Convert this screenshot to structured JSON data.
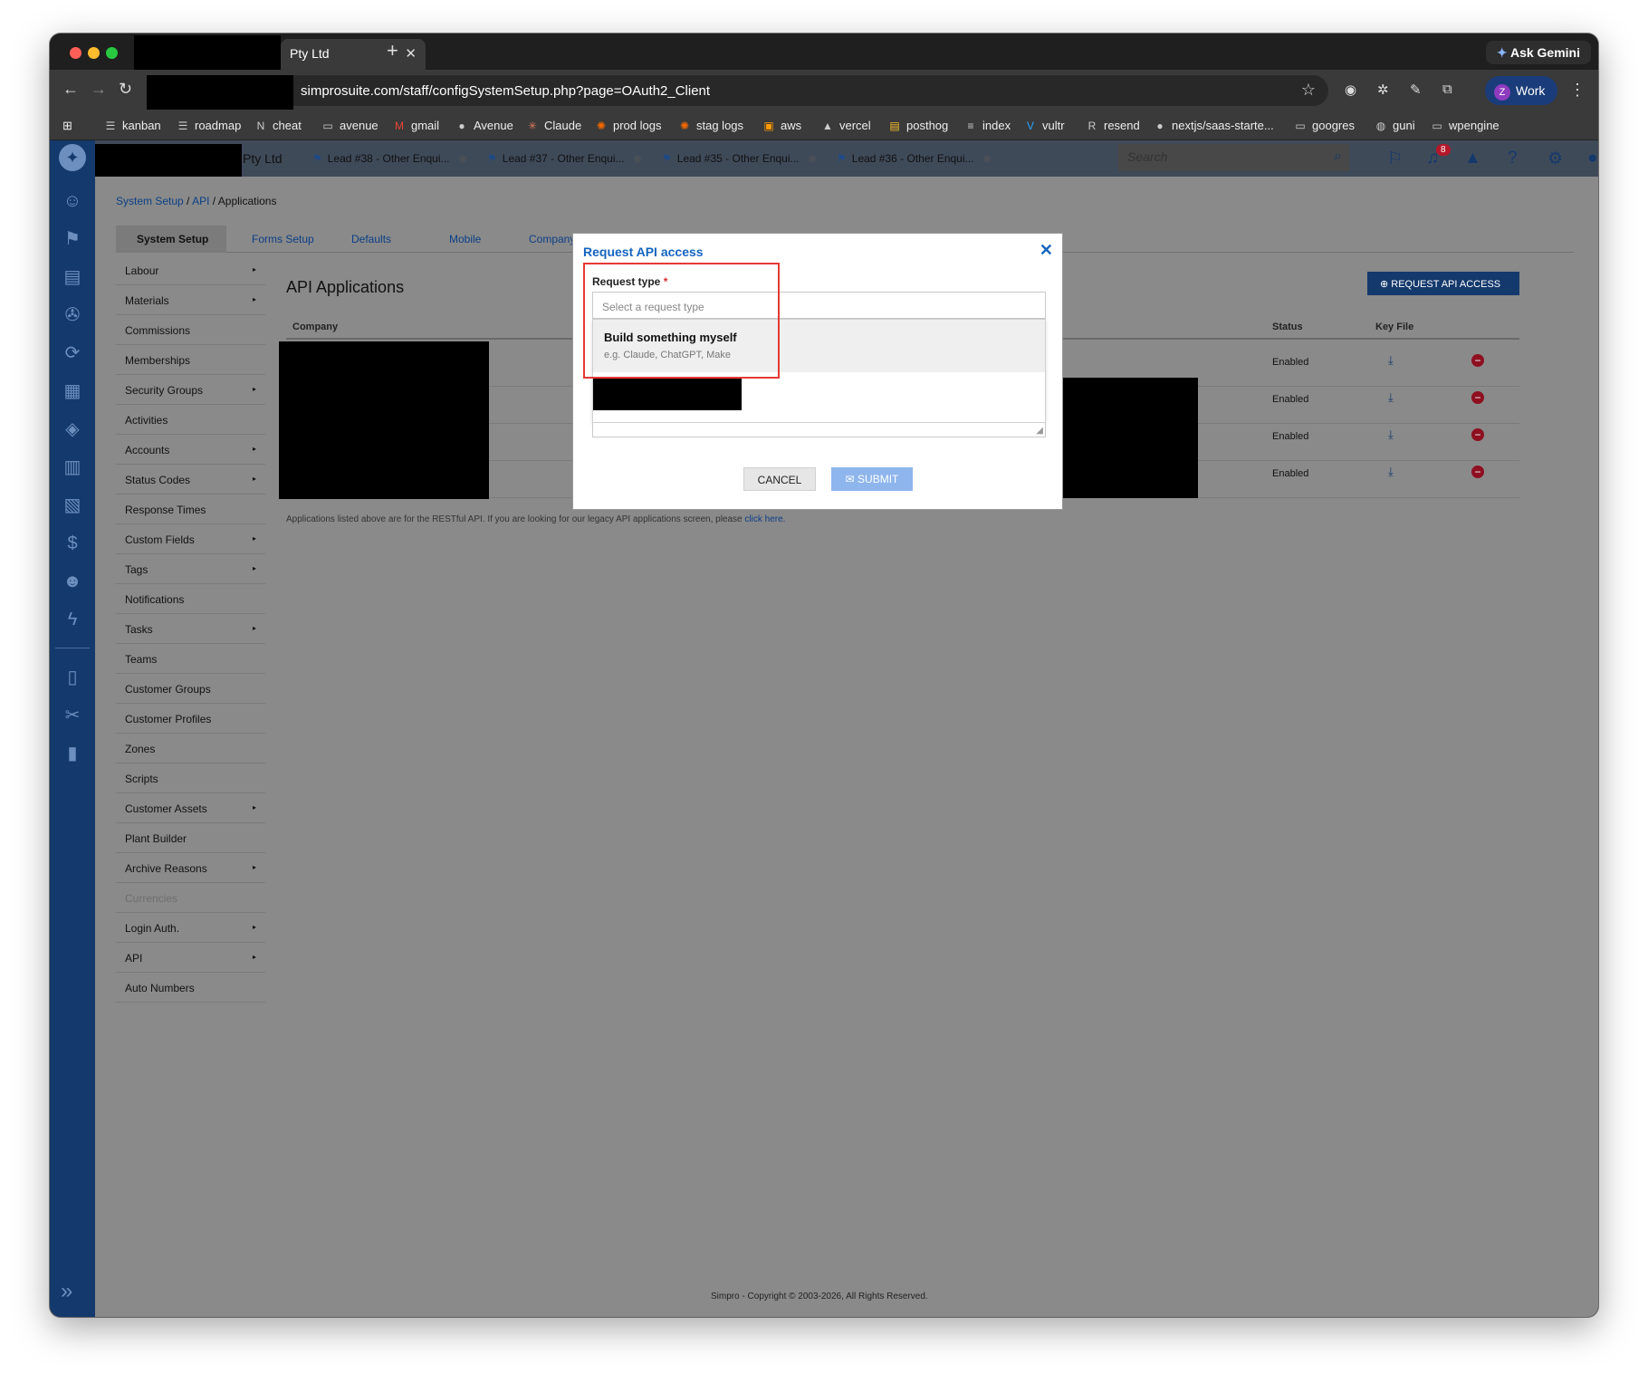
{
  "browser": {
    "active_tab": "Pty Ltd",
    "ask_gemini": "Ask Gemini",
    "url": "simprosuite.com/staff/configSystemSetup.php?page=OAuth2_Client",
    "profile_initial": "Z",
    "profile_label": "Work",
    "bookmarks": [
      "kanban",
      "roadmap",
      "cheat",
      "avenue",
      "gmail",
      "Avenue",
      "Claude",
      "prod logs",
      "stag logs",
      "aws",
      "vercel",
      "posthog",
      "index",
      "vultr",
      "resend",
      "nextjs/saas-starte...",
      "googres",
      "guni",
      "wpengine"
    ]
  },
  "header": {
    "company_suffix": "Pty Ltd",
    "lead_tabs": [
      "Lead #38 - Other Enqui...",
      "Lead #37 - Other Enqui...",
      "Lead #35 - Other Enqui...",
      "Lead #36 - Other Enqui..."
    ],
    "search_placeholder": "Search",
    "notification_count": "8"
  },
  "breadcrumb": {
    "system_setup": "System Setup",
    "api": "API",
    "current": "Applications"
  },
  "tabs": {
    "selected": "System Setup",
    "others": [
      "Forms Setup",
      "Defaults",
      "Mobile",
      "Company"
    ]
  },
  "menu": [
    {
      "label": "Labour",
      "arrow": "▸"
    },
    {
      "label": "Materials",
      "arrow": "▸"
    },
    {
      "label": "Commissions",
      "arrow": ""
    },
    {
      "label": "Memberships",
      "arrow": ""
    },
    {
      "label": "Security Groups",
      "arrow": "▸"
    },
    {
      "label": "Activities",
      "arrow": ""
    },
    {
      "label": "Accounts",
      "arrow": "▸"
    },
    {
      "label": "Status Codes",
      "arrow": "▸"
    },
    {
      "label": "Response Times",
      "arrow": ""
    },
    {
      "label": "Custom Fields",
      "arrow": "▸"
    },
    {
      "label": "Tags",
      "arrow": "▸"
    },
    {
      "label": "Notifications",
      "arrow": ""
    },
    {
      "label": "Tasks",
      "arrow": "▸"
    },
    {
      "label": "Teams",
      "arrow": ""
    },
    {
      "label": "Customer Groups",
      "arrow": ""
    },
    {
      "label": "Customer Profiles",
      "arrow": ""
    },
    {
      "label": "Zones",
      "arrow": ""
    },
    {
      "label": "Scripts",
      "arrow": ""
    },
    {
      "label": "Customer Assets",
      "arrow": "▸"
    },
    {
      "label": "Plant Builder",
      "arrow": ""
    },
    {
      "label": "Archive Reasons",
      "arrow": "▸"
    },
    {
      "label": "Currencies",
      "arrow": ""
    },
    {
      "label": "Login Auth.",
      "arrow": "▸"
    },
    {
      "label": "API",
      "arrow": "▸"
    },
    {
      "label": "Auto Numbers",
      "arrow": ""
    }
  ],
  "main": {
    "title": "API Applications",
    "request_button": "REQUEST API ACCESS",
    "columns": {
      "company": "Company",
      "status": "Status",
      "key_file": "Key File"
    },
    "rows": [
      {
        "status": "Enabled"
      },
      {
        "status": "Enabled"
      },
      {
        "status": "Enabled"
      },
      {
        "status": "Enabled"
      }
    ],
    "footnote": "Applications listed above are for the RESTful API. If you are looking for our legacy API applications screen, please",
    "footnote_link": "click here."
  },
  "footer": {
    "copyright": "Simpro - Copyright © 2003-2026, All Rights Reserved."
  },
  "modal": {
    "title": "Request API access",
    "field_label": "Request type",
    "required_mark": "*",
    "select_placeholder": "Select a request type",
    "option_title": "Build something myself",
    "option_desc": "e.g. Claude, ChatGPT, Make",
    "cancel": "CANCEL",
    "submit": "SUBMIT"
  },
  "colors": {
    "sidebar": "#14396c",
    "modal_title": "#1565c0",
    "highlight": "#e53935",
    "remove": "#8e1020"
  }
}
